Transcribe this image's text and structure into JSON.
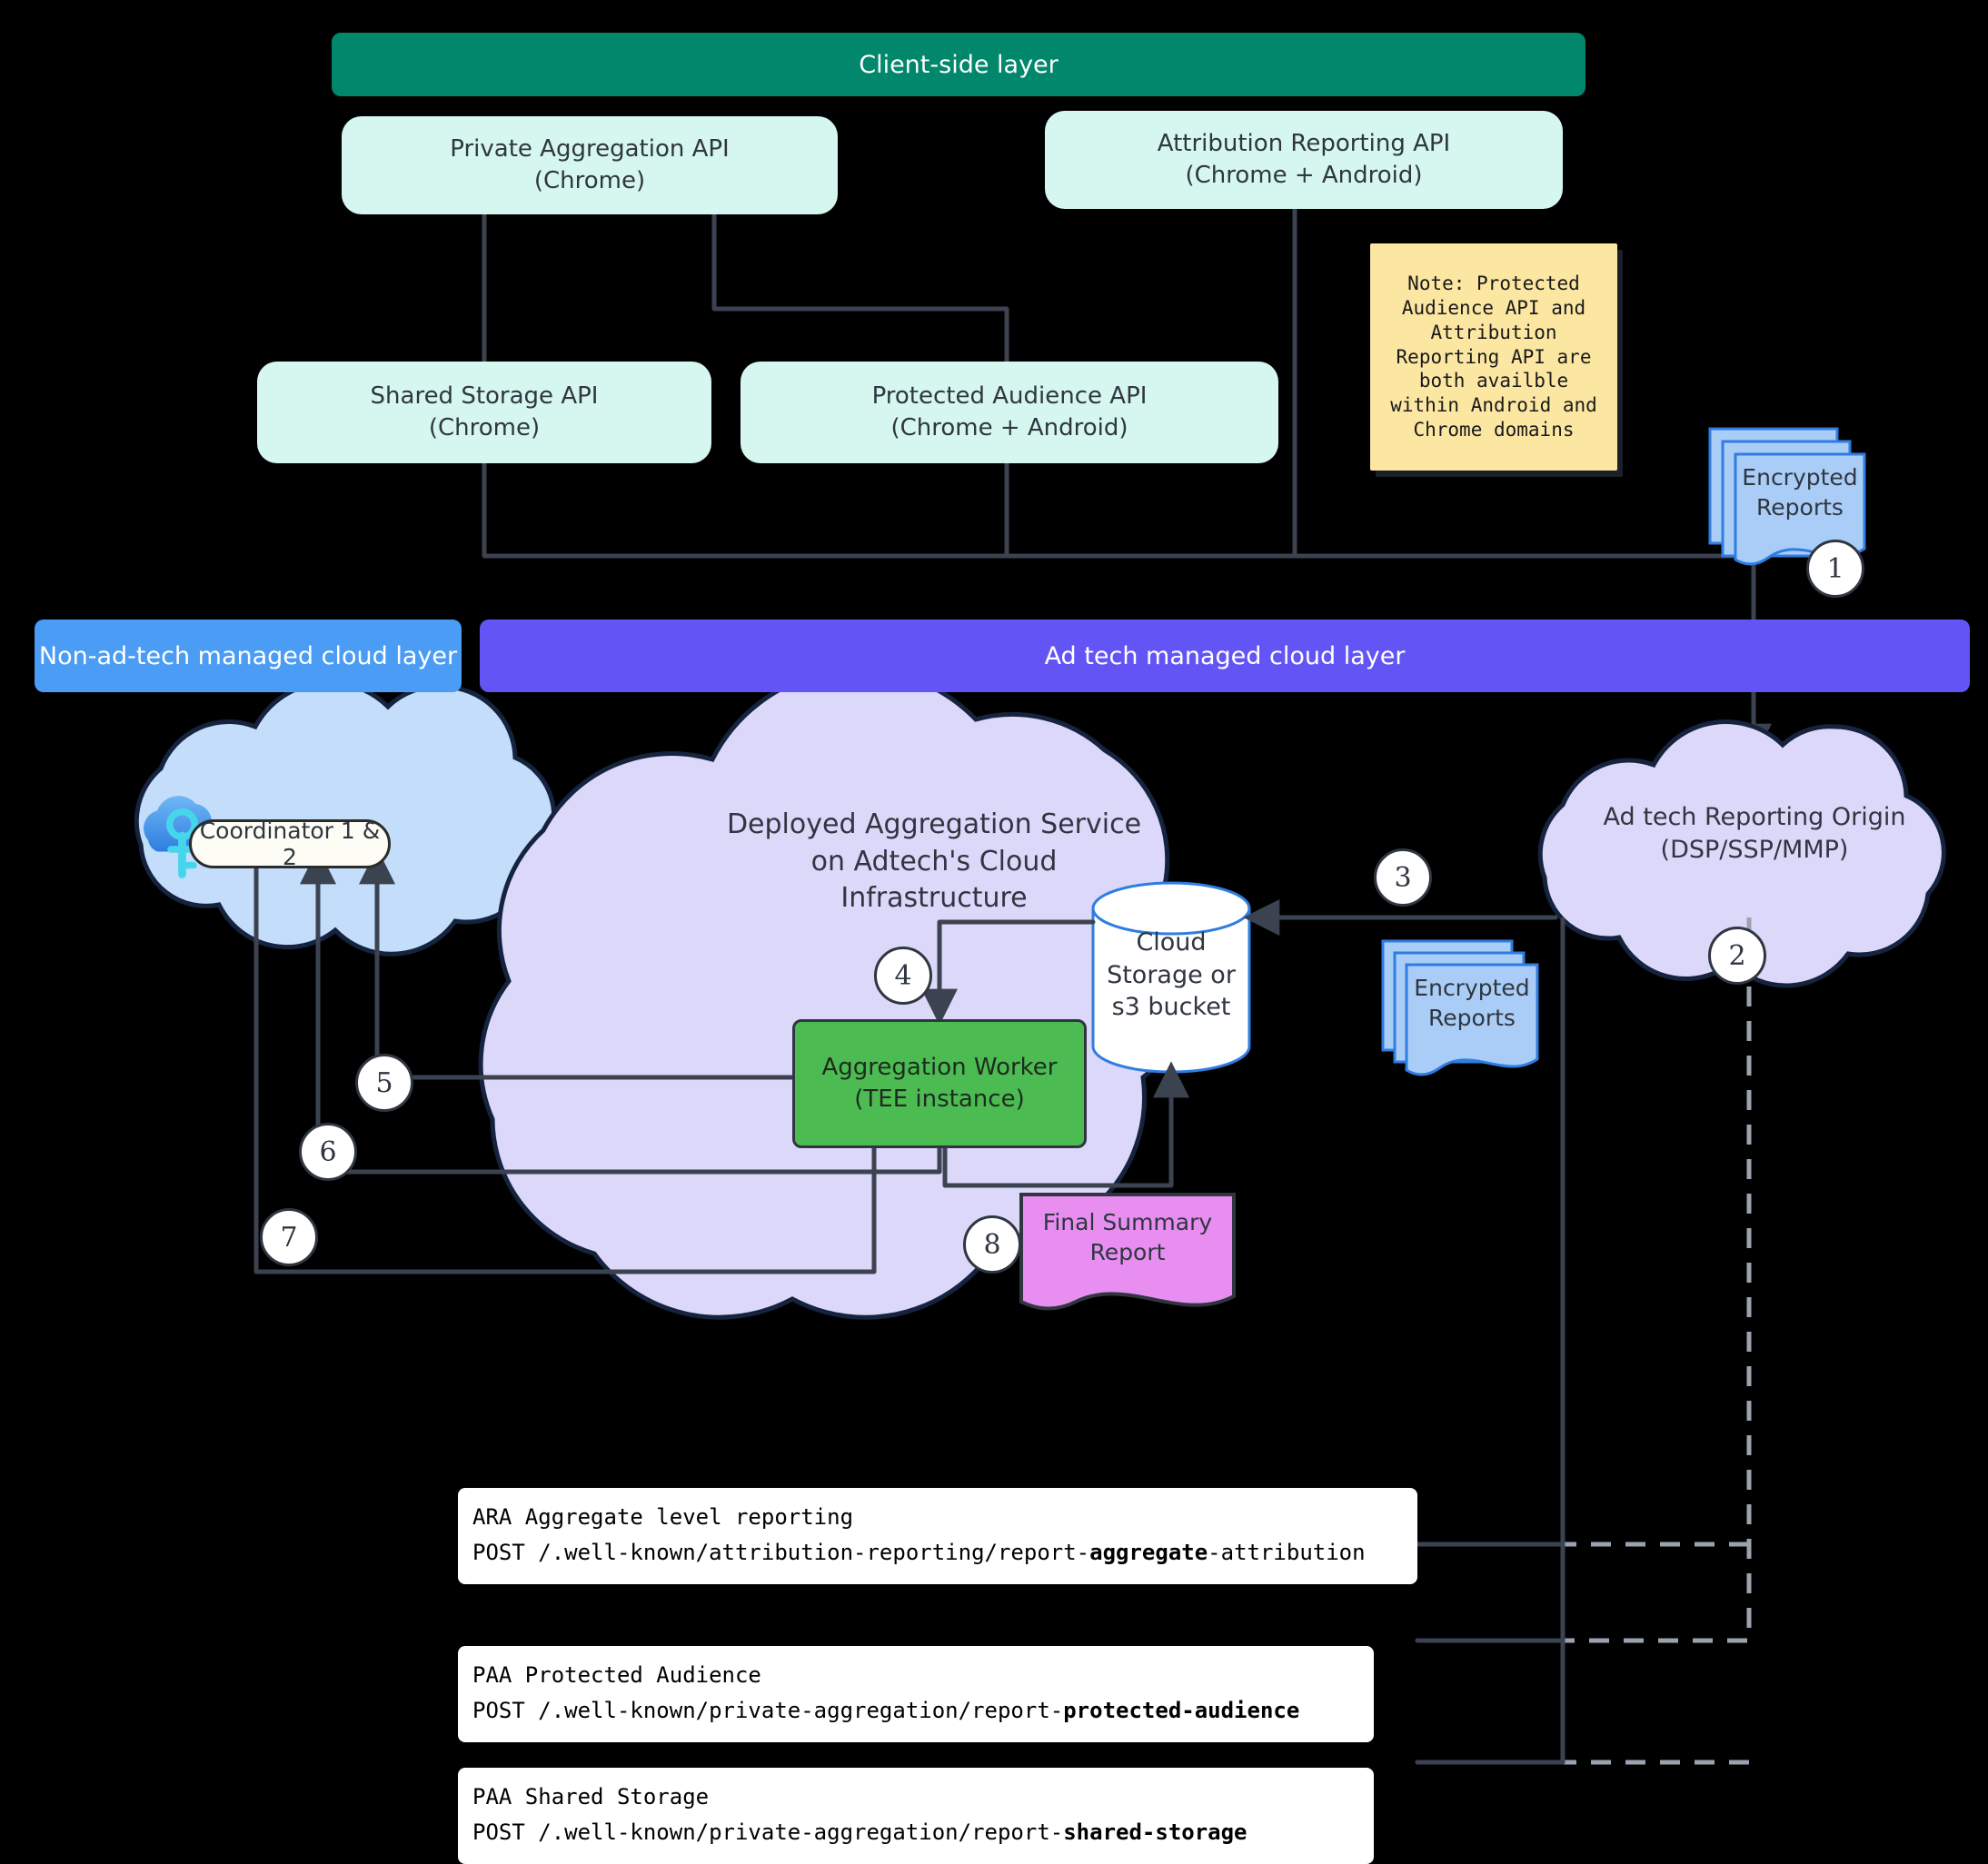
{
  "layers": {
    "client": "Client-side layer",
    "non_ad_tech": "Non-ad-tech managed cloud layer",
    "ad_tech": "Ad tech managed cloud layer"
  },
  "client_apis": [
    {
      "name": "Private Aggregation API",
      "platform": "(Chrome)"
    },
    {
      "name": "Attribution Reporting API",
      "platform": "(Chrome + Android)"
    },
    {
      "name": "Shared Storage API",
      "platform": "(Chrome)"
    },
    {
      "name": "Protected Audience API",
      "platform": "(Chrome + Android)"
    }
  ],
  "note": "Note: Protected Audience API and Attribution Reporting API are both availble within Android and Chrome domains",
  "encrypted_reports_label_line1": "Encrypted",
  "encrypted_reports_label_line2": "Reports",
  "coordinator": "Coordinator 1 & 2",
  "aggregation_service": {
    "title_line1": "Deployed Aggregation Service",
    "title_line2": "on Adtech's Cloud",
    "title_line3": "Infrastructure",
    "worker_line1": "Aggregation Worker",
    "worker_line2": "(TEE instance)",
    "storage_line1": "Cloud",
    "storage_line2": "Storage or",
    "storage_line3": "s3 bucket",
    "final_report_line1": "Final Summary",
    "final_report_line2": "Report"
  },
  "reporting_origin": {
    "line1": "Ad tech Reporting Origin",
    "line2": "(DSP/SSP/MMP)"
  },
  "steps": [
    "1",
    "2",
    "3",
    "4",
    "5",
    "6",
    "7",
    "8"
  ],
  "endpoints": [
    {
      "title": "ARA Aggregate level reporting",
      "method": "POST",
      "path_pre": " /.well-known/attribution-reporting/report-",
      "path_bold": "aggregate",
      "path_post": "-attribution"
    },
    {
      "title": "PAA Protected Audience",
      "method": "POST",
      "path_pre": " /.well-known/private-aggregation/report-",
      "path_bold": "protected-audience",
      "path_post": ""
    },
    {
      "title": "PAA Shared Storage",
      "method": "POST",
      "path_pre": " /.well-known/private-aggregation/report-",
      "path_bold": "shared-storage",
      "path_post": ""
    }
  ],
  "colors": {
    "client_layer": "#00876c",
    "non_ad_tech_layer": "#4a9cf5",
    "ad_tech_layer": "#6355f5",
    "api_box": "#d6f7f0",
    "note": "#fbe6a2",
    "worker": "#4cbb52",
    "report_doc": "#a9cdf7",
    "summary_doc": "#e88ef0",
    "service_cloud": "#dcd8fa",
    "coordinator_cloud": "#c3ddfb",
    "line": "#3b4250"
  }
}
